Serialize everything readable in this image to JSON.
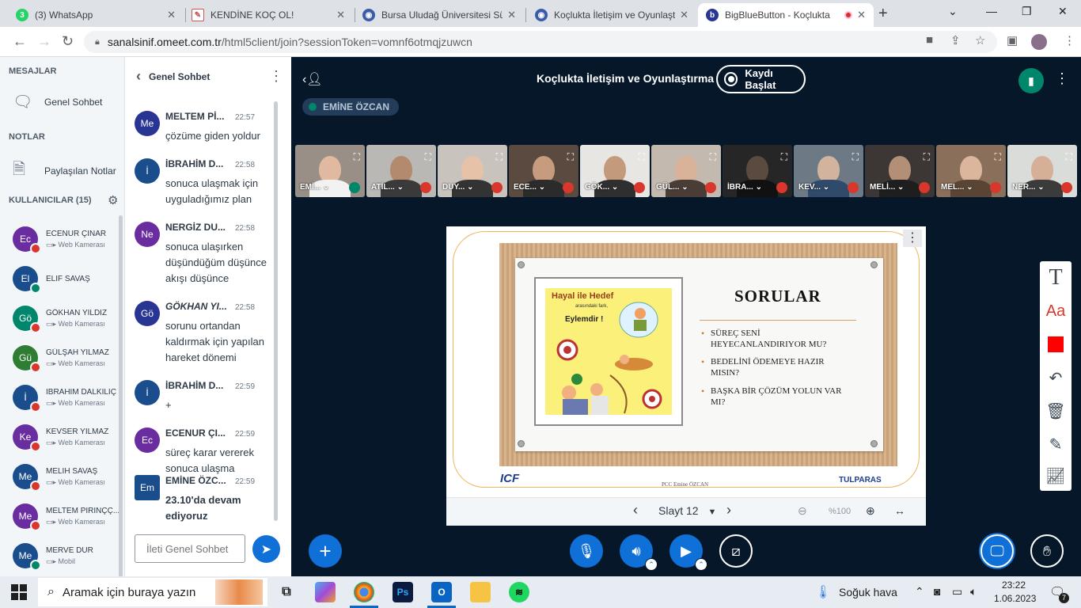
{
  "browser": {
    "tabs": [
      {
        "title": "(3) WhatsApp",
        "icon": "whatsapp-icon",
        "color": "#25d366",
        "glyph": "3"
      },
      {
        "title": "KENDİNE KOÇ OL!",
        "icon": "document-icon",
        "color": "#e8eaed",
        "glyph": ""
      },
      {
        "title": "Bursa Uludağ Üniversitesi Sür",
        "icon": "globe-icon",
        "color": "#3a5ca8",
        "glyph": ""
      },
      {
        "title": "Koçlukta İletişim ve Oyunlaştır",
        "icon": "globe-icon",
        "color": "#3a5ca8",
        "glyph": ""
      },
      {
        "title": "BigBlueButton - Koçlukta",
        "icon": "bbb-icon",
        "color": "#283593",
        "glyph": "b"
      }
    ],
    "url_host": "sanalsinif.omeet.com.tr",
    "url_path": "/html5client/join?sessionToken=vomnf6otmqjzuwcn"
  },
  "sidebar": {
    "messages_header": "MESAJLAR",
    "public_chat": "Genel Sohbet",
    "notes_header": "NOTLAR",
    "shared_notes": "Paylaşılan Notlar",
    "users_header": "KULLANICILAR (15)",
    "users": [
      {
        "initials": "Ec",
        "name": "ECENUR ÇINAR",
        "sub": "Web Kamerası",
        "color": "#6a2da0",
        "badge": "mute"
      },
      {
        "initials": "El",
        "name": "ELİF SAVAŞ",
        "sub": "",
        "color": "#1a4d8c",
        "badge": "ok"
      },
      {
        "initials": "Gö",
        "name": "GÖKHAN YILDIZ",
        "sub": "Web Kamerası",
        "color": "#00876b",
        "badge": "mute"
      },
      {
        "initials": "Gü",
        "name": "GÜLŞAH YILMAZ",
        "sub": "Web Kamerası",
        "color": "#2e7d32",
        "badge": "mute"
      },
      {
        "initials": "İ",
        "name": "İBRAHİM DALKILIÇ",
        "sub": "Web Kamerası",
        "color": "#1a4d8c",
        "badge": "mute"
      },
      {
        "initials": "Ke",
        "name": "KEVSER YILMAZ",
        "sub": "Web Kamerası",
        "color": "#6a2da0",
        "badge": "mute"
      },
      {
        "initials": "Me",
        "name": "MELİH SAVAŞ",
        "sub": "Web Kamerası",
        "color": "#1a4d8c",
        "badge": "mute"
      },
      {
        "initials": "Me",
        "name": "MELTEM PİRİNÇÇ...",
        "sub": "Web Kamerası",
        "color": "#6a2da0",
        "badge": "mute"
      },
      {
        "initials": "Me",
        "name": "MERVE DUR",
        "sub": "Mobil",
        "color": "#1a4d8c",
        "badge": "ok"
      }
    ]
  },
  "chat": {
    "title": "Genel Sohbet",
    "messages": [
      {
        "initials": "Me",
        "color": "#283593",
        "name": "MELTEM Pİ...",
        "time": "22:57",
        "text": "çözüme giden yoldur",
        "italic": false,
        "bold": false,
        "square": false
      },
      {
        "initials": "İ",
        "color": "#1a4d8c",
        "name": "İBRAHİM D...",
        "time": "22:58",
        "text": "sonuca ulaşmak için uyguladığımız plan",
        "italic": false,
        "bold": false,
        "square": false
      },
      {
        "initials": "Ne",
        "color": "#6a2da0",
        "name": "NERGİZ DU...",
        "time": "22:58",
        "text": "sonuca ulaşırken düşündüğüm düşünce akışı düşünce",
        "italic": false,
        "bold": false,
        "square": false
      },
      {
        "initials": "Gö",
        "color": "#283593",
        "name": "GÖKHAN YI...",
        "time": "22:58",
        "text": "sorunu ortandan kaldırmak için yapılan hareket dönemi",
        "italic": true,
        "bold": false,
        "square": false
      },
      {
        "initials": "İ",
        "color": "#1a4d8c",
        "name": "İBRAHİM D...",
        "time": "22:59",
        "text": "+",
        "italic": false,
        "bold": false,
        "square": false
      },
      {
        "initials": "Ec",
        "color": "#6a2da0",
        "name": "ECENUR ÇI...",
        "time": "22:59",
        "text": "süreç karar vererek sonuca ulaşma",
        "italic": false,
        "bold": false,
        "square": false
      },
      {
        "initials": "Em",
        "color": "#1a4d8c",
        "name": "EMİNE ÖZC...",
        "time": "22:59",
        "text": "23.10'da devam ediyoruz",
        "italic": false,
        "bold": true,
        "square": true
      }
    ],
    "input_placeholder": "İleti Genel Sohbet"
  },
  "meeting": {
    "title": "Koçlukta İletişim ve Oyunlaştırma",
    "record_label": "Kaydı Başlat",
    "presenter": "EMİNE ÖZCAN",
    "cameras": [
      {
        "label": "EMİ...",
        "bg": "#9a8f86",
        "skin": "#e0b9a0",
        "shirt": "#f2f2f2",
        "mic": "ok"
      },
      {
        "label": "ATİL...",
        "bg": "#b9b8b5",
        "skin": "#b38a6e",
        "shirt": "#3a3a3a",
        "mic": "mute"
      },
      {
        "label": "DUY...",
        "bg": "#c9c3bd",
        "skin": "#e6c2a8",
        "shirt": "#333333",
        "mic": "mute"
      },
      {
        "label": "ECE...",
        "bg": "#5b4a40",
        "skin": "#c79b7d",
        "shirt": "#2b2b2b",
        "mic": "mute"
      },
      {
        "label": "GÖK...",
        "bg": "#e8e6e2",
        "skin": "#c49a7c",
        "shirt": "#2f2f2f",
        "mic": "mute"
      },
      {
        "label": "GÜL...",
        "bg": "#c4b9ae",
        "skin": "#dab29a",
        "shirt": "#4a3d35",
        "mic": "mute"
      },
      {
        "label": "İBRA...",
        "bg": "#262626",
        "skin": "#5a4a40",
        "shirt": "#111111",
        "mic": "mute"
      },
      {
        "label": "KEV...",
        "bg": "#6d7a86",
        "skin": "#d2b49e",
        "shirt": "#2f4a6a",
        "mic": "mute"
      },
      {
        "label": "MELİ...",
        "bg": "#3c3634",
        "skin": "#b38f78",
        "shirt": "#1e1e1e",
        "mic": "mute"
      },
      {
        "label": "MEL...",
        "bg": "#8a6f5a",
        "skin": "#dcb69c",
        "shirt": "#5a4535",
        "mic": "mute"
      },
      {
        "label": "NER...",
        "bg": "#d9dcd9",
        "skin": "#d6b096",
        "shirt": "#3b3b3b",
        "mic": "mute"
      }
    ],
    "slide": {
      "title": "SORULAR",
      "bullets": [
        "SÜREÇ SENİ HEYECANLANDIRIYOR MU?",
        "BEDELİNİ ÖDEMEYE HAZIR MISIN?",
        "BAŞKA BİR ÇÖZÜM YOLUN VAR MI?"
      ],
      "cartoon_title": "Hayal ile Hedef",
      "cartoon_sub": "arasındaki fark,",
      "cartoon_line": "Eylemdir !",
      "footer_left": "ICF",
      "footer_center": "PCC Emine ÖZCAN",
      "footer_right": "TULPARAS",
      "current": "Slayt 12",
      "zoom": "%100"
    }
  },
  "taskbar": {
    "search_placeholder": "Aramak için buraya yazın",
    "weather": "Soğuk hava",
    "time": "23:22",
    "date": "1.06.2023",
    "notifications": "7"
  }
}
